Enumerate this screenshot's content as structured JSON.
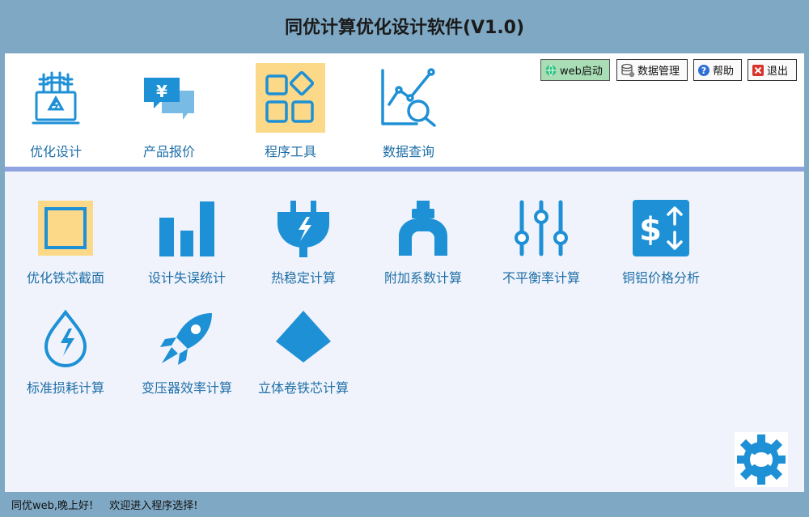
{
  "app": {
    "title": "同优计算优化设计软件(V1.0)"
  },
  "nav": {
    "items": [
      {
        "label": "优化设计",
        "icon": "transformer-icon"
      },
      {
        "label": "产品报价",
        "icon": "price-chat-icon"
      },
      {
        "label": "程序工具",
        "icon": "grid-tools-icon",
        "active": true
      },
      {
        "label": "数据查询",
        "icon": "chart-search-icon"
      }
    ]
  },
  "toolbar": {
    "web_label": "web启动",
    "data_label": "数据管理",
    "help_label": "帮助",
    "exit_label": "退出"
  },
  "tools": {
    "items": [
      {
        "label": "优化铁芯截面"
      },
      {
        "label": "设计失误统计"
      },
      {
        "label": "热稳定计算"
      },
      {
        "label": "附加系数计算"
      },
      {
        "label": "不平衡率计算"
      },
      {
        "label": "铜铝价格分析"
      },
      {
        "label": "标准损耗计算"
      },
      {
        "label": "变压器效率计算"
      },
      {
        "label": "立体卷铁芯计算"
      }
    ]
  },
  "status": {
    "greeting": "同优web,晚上好!",
    "message": "欢迎进入程序选择!"
  },
  "colors": {
    "accent": "#1e90d6",
    "label": "#1f6fa8",
    "highlight": "#fbd988",
    "background": "#7fa8c4"
  }
}
